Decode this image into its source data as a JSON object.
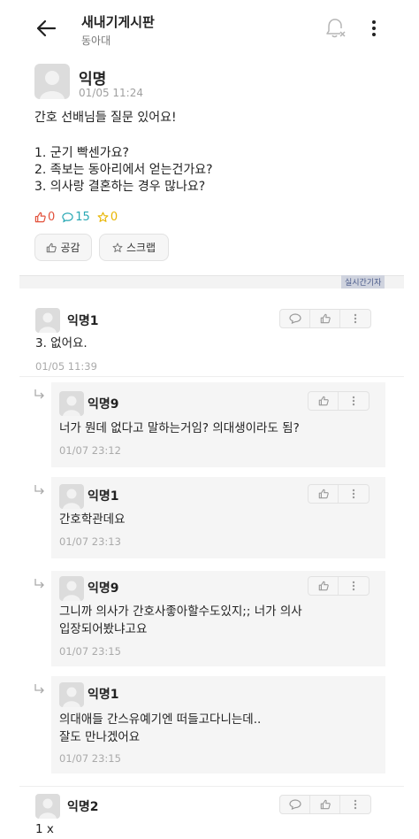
{
  "header": {
    "title": "새내기게시판",
    "subtitle": "동아대",
    "icons": [
      "back-arrow-icon",
      "notification-off-icon",
      "more-vert-icon"
    ]
  },
  "post": {
    "author": "익명",
    "time": "01/05 11:24",
    "title": "간호 선배님들 질문 있어요!",
    "lines": [
      "1. 군기 빡센가요?",
      "2. 족보는 동아리에서 얻는건가요?",
      "3. 의사랑 결혼하는 경우 많나요?"
    ],
    "stats": {
      "likes": "0",
      "comments": "15",
      "scraps": "0"
    },
    "buttons": {
      "like": "공감",
      "scrap": "스크랩"
    },
    "colors": {
      "like": "#e2513b",
      "comment": "#29a8b4",
      "scrap": "#e8b500"
    }
  },
  "banner": {
    "watermark": "실시간기자"
  },
  "comments": [
    {
      "author": "익명1",
      "lines": [
        "3. 없어요."
      ],
      "time": "01/05 11:39"
    },
    {
      "author": "익명9",
      "lines": [
        "너가 뭔데 없다고 말하는거임? 의대생이라도 됨?"
      ],
      "time": "01/07 23:12"
    },
    {
      "author": "익명1",
      "lines": [
        "간호학관데요"
      ],
      "time": "01/07 23:13"
    },
    {
      "author": "익명9",
      "lines": [
        "그니까 의사가 간호사좋아할수도있지;; 너가 의사",
        "입장되어봤냐고요"
      ],
      "time": "01/07 23:15"
    },
    {
      "author": "익명1",
      "lines": [
        "의대애들 간스유예기엔 떠들고다니는데..",
        "잘도 만나겠어요"
      ],
      "time": "01/07 23:15"
    },
    {
      "author": "익명2",
      "lines": [
        "1 x"
      ]
    }
  ]
}
